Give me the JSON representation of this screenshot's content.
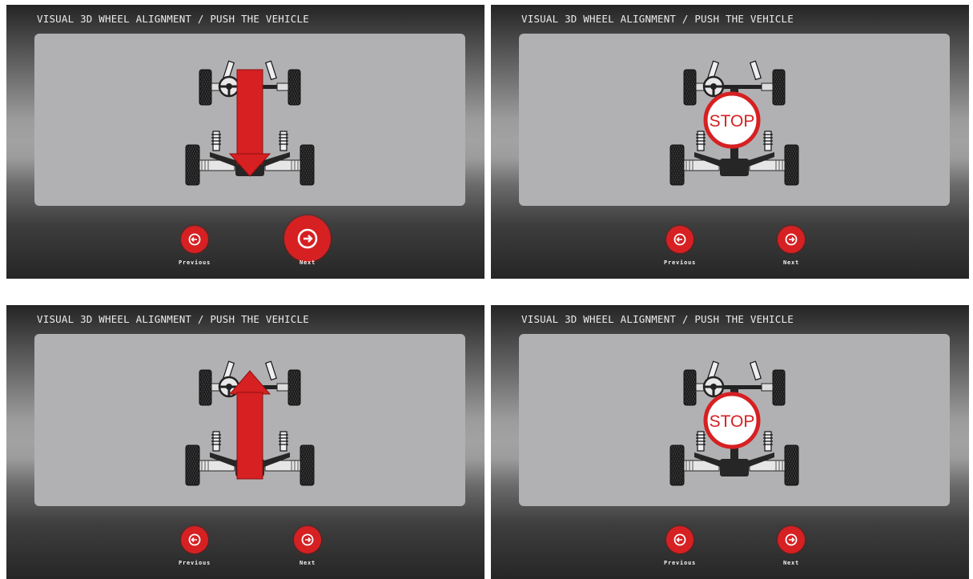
{
  "screens": [
    {
      "title": "VISUAL 3D WHEEL ALIGNMENT / PUSH THE VEHICLE",
      "indicator": "arrow-down",
      "previous_label": "Previous",
      "next_label": "Next",
      "next_emphasized": true
    },
    {
      "title": "VISUAL 3D WHEEL ALIGNMENT / PUSH THE VEHICLE",
      "indicator": "stop-sign",
      "stop_text": "STOP",
      "previous_label": "Previous",
      "next_label": "Next",
      "next_emphasized": false
    },
    {
      "title": "VISUAL 3D WHEEL ALIGNMENT / PUSH THE VEHICLE",
      "indicator": "arrow-up",
      "previous_label": "Previous",
      "next_label": "Next",
      "next_emphasized": false
    },
    {
      "title": "VISUAL 3D WHEEL ALIGNMENT / PUSH THE VEHICLE",
      "indicator": "stop-sign",
      "stop_text": "STOP",
      "previous_label": "Previous",
      "next_label": "Next",
      "next_emphasized": false
    }
  ],
  "colors": {
    "accent_red": "#d62022",
    "panel_gray": "#b1b1b3",
    "chassis_dark": "#262626"
  },
  "icons": {
    "previous": "arrow-left-circle-icon",
    "next": "arrow-right-circle-icon"
  }
}
